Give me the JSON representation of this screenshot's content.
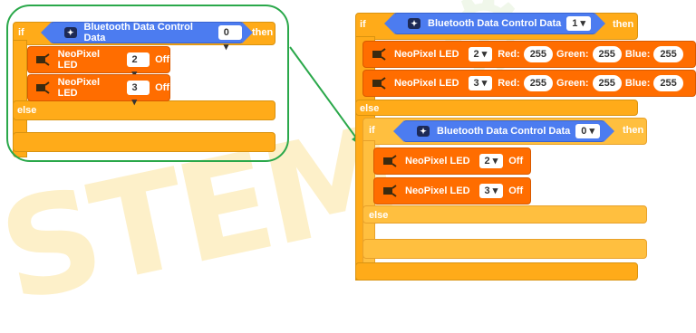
{
  "watermark": {
    "left": "STEM",
    "right": "⚙"
  },
  "keywords": {
    "if": "if",
    "then": "then",
    "else": "else"
  },
  "left": {
    "condition": {
      "label": "Bluetooth Data Control Data",
      "value": "0 ▾"
    },
    "leds": [
      {
        "label": "NeoPixel LED",
        "index": "2 ▾",
        "state": "Off"
      },
      {
        "label": "NeoPixel LED",
        "index": "3 ▾",
        "state": "Off"
      }
    ]
  },
  "right": {
    "condition": {
      "label": "Bluetooth Data Control Data",
      "value": "1 ▾"
    },
    "leds": [
      {
        "label": "NeoPixel LED",
        "index": "2 ▾",
        "red_label": "Red:",
        "red": "255",
        "green_label": "Green:",
        "green": "255",
        "blue_label": "Blue:",
        "blue": "255"
      },
      {
        "label": "NeoPixel LED",
        "index": "3 ▾",
        "red_label": "Red:",
        "red": "255",
        "green_label": "Green:",
        "green": "255",
        "blue_label": "Blue:",
        "blue": "255"
      }
    ],
    "inner": {
      "condition": {
        "label": "Bluetooth Data Control Data",
        "value": "0 ▾"
      },
      "leds": [
        {
          "label": "NeoPixel LED",
          "index": "2 ▾",
          "state": "Off"
        },
        {
          "label": "NeoPixel LED",
          "index": "3 ▾",
          "state": "Off"
        }
      ]
    }
  },
  "colors": {
    "control": "#ffab19",
    "bluetooth": "#4c7cf0",
    "neopixel": "#ff6d00",
    "highlight": "#2aa84a"
  }
}
